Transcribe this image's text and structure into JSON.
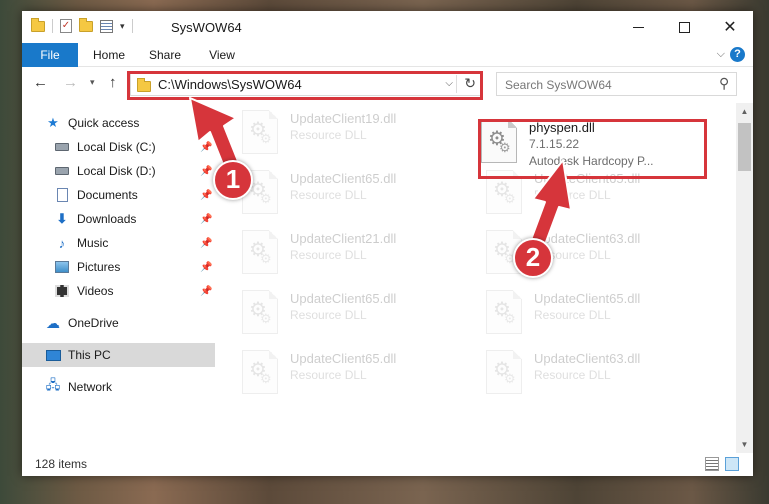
{
  "window": {
    "title": "SysWOW64"
  },
  "ribbon": {
    "tabs": [
      "File",
      "Home",
      "Share",
      "View"
    ]
  },
  "navbar": {
    "address": "C:\\Windows\\SysWOW64",
    "search_placeholder": "Search SysWOW64"
  },
  "sidebar": {
    "items": [
      {
        "label": "Quick access",
        "icon": "star-icon"
      },
      {
        "label": "Local Disk (C:)",
        "icon": "drive-icon",
        "pinned": true
      },
      {
        "label": "Local Disk (D:)",
        "icon": "drive-icon",
        "pinned": true
      },
      {
        "label": "Documents",
        "icon": "documents-icon",
        "pinned": true
      },
      {
        "label": "Downloads",
        "icon": "downloads-icon",
        "pinned": true
      },
      {
        "label": "Music",
        "icon": "music-icon",
        "pinned": true
      },
      {
        "label": "Pictures",
        "icon": "pictures-icon",
        "pinned": true
      },
      {
        "label": "Videos",
        "icon": "videos-icon",
        "pinned": true
      },
      {
        "label": "OneDrive",
        "icon": "onedrive-icon"
      },
      {
        "label": "This PC",
        "icon": "computer-icon",
        "selected": true
      },
      {
        "label": "Network",
        "icon": "network-icon"
      }
    ]
  },
  "files": [
    {
      "name": "UpdateClient19.dll",
      "desc": "Resource DLL",
      "faded": true
    },
    {
      "name": "physpen.dll",
      "version": "7.1.15.22",
      "desc": "Autodesk Hardcopy P...",
      "faded": false,
      "highlighted": true
    },
    {
      "name": "UpdateClient65.dll",
      "desc": "Resource DLL",
      "faded": true
    },
    {
      "name": "UpdateClient65.dll",
      "desc": "Resource DLL",
      "faded": true
    },
    {
      "name": "UpdateClient21.dll",
      "desc": "Resource DLL",
      "faded": true
    },
    {
      "name": "UpdateClient63.dll",
      "desc": "Resource DLL",
      "faded": true
    },
    {
      "name": "UpdateClient65.dll",
      "desc": "Resource DLL",
      "faded": true
    },
    {
      "name": "UpdateClient65.dll",
      "desc": "Resource DLL",
      "faded": true
    },
    {
      "name": "UpdateClient65.dll",
      "desc": "Resource DLL",
      "faded": true
    },
    {
      "name": "UpdateClient63.dll",
      "desc": "Resource DLL",
      "faded": true
    }
  ],
  "status": {
    "item_count": "128 items"
  },
  "annotations": {
    "step1": "1",
    "step2": "2",
    "color": "#d6353b"
  }
}
